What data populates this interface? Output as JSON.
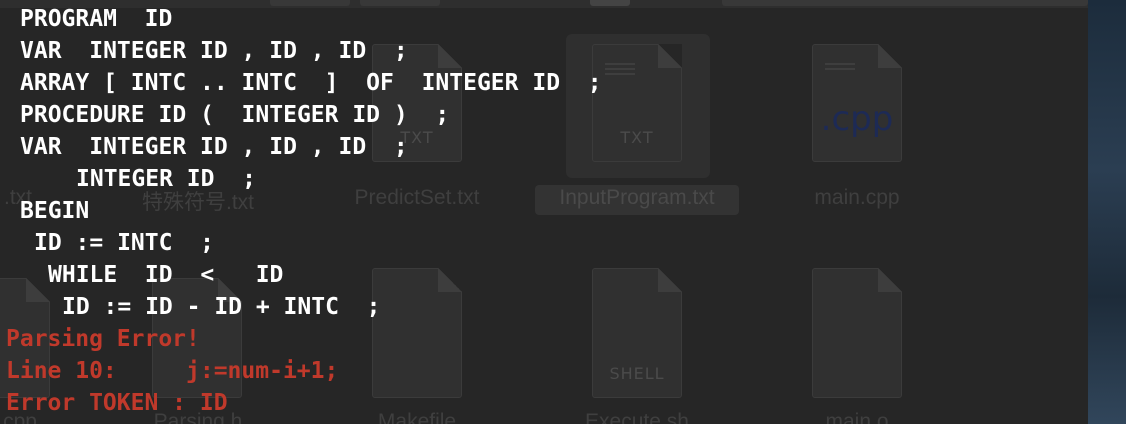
{
  "terminal": {
    "lines": [
      "PROGRAM  ID",
      "VAR  INTEGER ID , ID , ID  ;",
      "ARRAY [ INTC .. INTC  ]  OF  INTEGER ID  ;",
      "PROCEDURE ID (  INTEGER ID )  ;",
      "VAR  INTEGER ID , ID , ID  ;",
      "INTEGER ID  ;",
      "BEGIN",
      "ID := INTC  ;",
      "WHILE  ID  <   ID",
      "ID := ID - ID + INTC  ;"
    ],
    "errors": [
      "Parsing Error!",
      "Line 10:     j:=num-i+1;",
      "Error TOKEN : ID"
    ],
    "text_color": "#ffffff",
    "error_color": "#c0392b"
  },
  "finder": {
    "files": [
      {
        "name": ".txt",
        "icon": "text-document-icon",
        "tag": ""
      },
      {
        "name": "特殊符号.txt",
        "icon": "text-document-icon",
        "tag": ""
      },
      {
        "name": "PredictSet.txt",
        "icon": "text-document-icon",
        "tag": "TXT"
      },
      {
        "name": "InputProgram.txt",
        "icon": "text-document-icon",
        "tag": "TXT",
        "selected": true
      },
      {
        "name": "main.cpp",
        "icon": "cpp-document-icon",
        "tag": ".cpp"
      },
      {
        "name": "cpp",
        "icon": "cpp-document-icon",
        "tag": ""
      },
      {
        "name": "Parsing.h",
        "icon": "header-document-icon",
        "tag": ""
      },
      {
        "name": "Makefile",
        "icon": "makefile-document-icon",
        "tag": ""
      },
      {
        "name": "Execute.sh",
        "icon": "shell-document-icon",
        "tag": "SHELL"
      },
      {
        "name": "main.o",
        "icon": "object-document-icon",
        "tag": ""
      }
    ]
  }
}
